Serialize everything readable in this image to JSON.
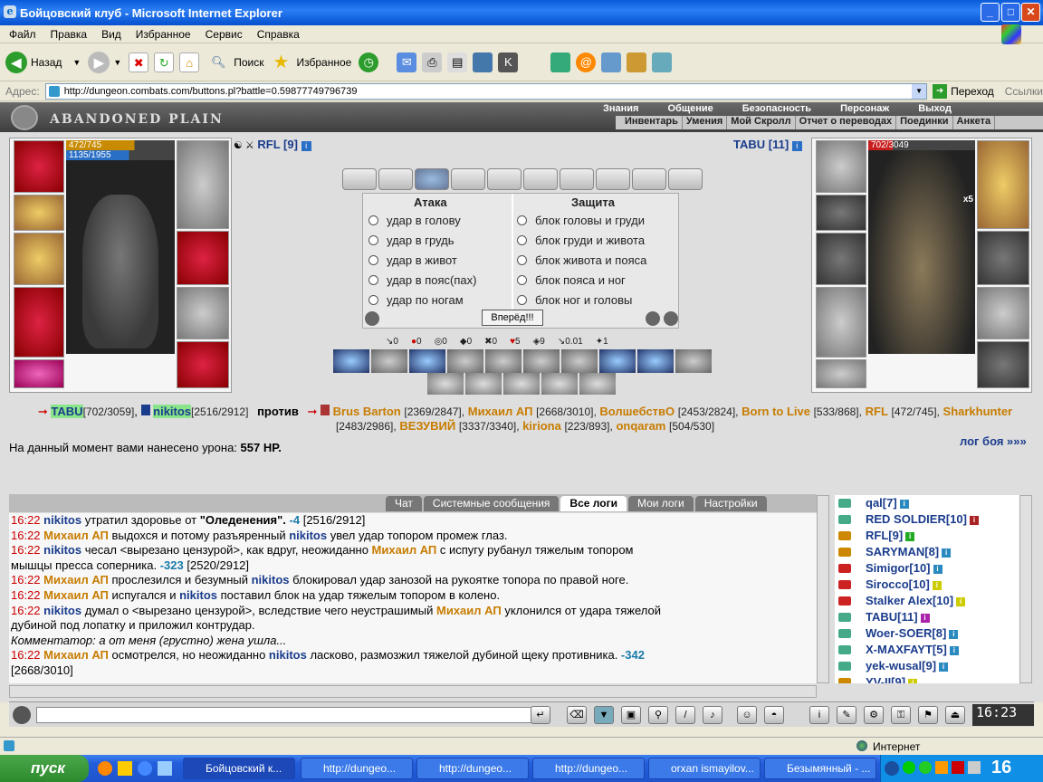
{
  "window": {
    "title": "Бойцовский клуб - Microsoft Internet Explorer",
    "buttons": [
      "_",
      "□",
      "✕"
    ]
  },
  "menu": [
    "Файл",
    "Правка",
    "Вид",
    "Избранное",
    "Сервис",
    "Справка"
  ],
  "toolbar": {
    "back": "Назад",
    "search": "Поиск",
    "favorites": "Избранное"
  },
  "address": {
    "label": "Адрес:",
    "url": "http://dungeon.combats.com/buttons.pl?battle=0.59877749796739",
    "go": "Переход",
    "links": "Ссылки"
  },
  "game": {
    "location": "ABANDONED PLAIN",
    "top_menu": [
      "Знания",
      "Общение",
      "Безопасность",
      "Персонаж",
      "Выход"
    ],
    "sub_menu": [
      "Инвентарь",
      "Умения",
      "Мой Скролл",
      "Отчет о переводах",
      "Поединки",
      "Анкета"
    ],
    "player": {
      "name": "RFL [9]",
      "hp": "472/745",
      "mana": "1135/1955"
    },
    "enemy": {
      "name": "TABU [11]",
      "hp": "702/3049",
      "count": "x5"
    },
    "attack": {
      "title": "Атака",
      "options": [
        "удар в голову",
        "удар в грудь",
        "удар в живот",
        "удар в пояс(пах)",
        "удар по ногам"
      ]
    },
    "defense": {
      "title": "Защита",
      "options": [
        "блок головы и груди",
        "блок груди и живота",
        "блок живота и пояса",
        "блок пояса и ног",
        "блок ног и головы"
      ]
    },
    "forward_button": "Вперёд!!!",
    "stats": [
      "0",
      "0",
      "0",
      "0",
      "0",
      "5",
      "9",
      "0.01",
      "1"
    ],
    "team1": [
      {
        "name": "TABU",
        "hp": "[702/3059]"
      },
      {
        "name": "nikitos",
        "hp": "[2516/2912]"
      }
    ],
    "vs": "против",
    "team2": [
      {
        "name": "Brus Barton",
        "hp": "[2369/2847],"
      },
      {
        "name": "Михаил АП",
        "hp": "[2668/3010],"
      },
      {
        "name": "ВолшебствО",
        "hp": "[2453/2824],"
      },
      {
        "name": "Born to Live",
        "hp": "[533/868],"
      },
      {
        "name": "RFL",
        "hp": "[472/745],"
      },
      {
        "name": "Sharkhunter",
        "hp": "[2483/2986],"
      },
      {
        "name": "ВЕЗУВИЙ",
        "hp": "[3337/3340],"
      },
      {
        "name": "kiriona",
        "hp": "[223/893],"
      },
      {
        "name": "onqaram",
        "hp": "[504/530]"
      }
    ],
    "damage_text": "На данный момент вами нанесено урона:",
    "damage_value": "557 HP.",
    "battle_log_link": "лог боя »»»"
  },
  "chat": {
    "tabs": [
      "Чат",
      "Системные сообщения",
      "Все логи",
      "Мои логи",
      "Настройки"
    ],
    "log": [
      {
        "t": "16:22",
        "a": "nikitos",
        "text": " утратил здоровье от ",
        "b": "\"Оледенения\".",
        "dmg": " -4",
        "hp": " [2516/2912]"
      },
      {
        "t": "16:22",
        "a": "Михаил АП",
        "text": " выдохся и потому разъяренный ",
        "b": "nikitos",
        "text2": " увел удар топором промеж глаз."
      },
      {
        "t": "16:22",
        "a": "nikitos",
        "text": " чесал <вырезано цензурой>, как вдруг, неожиданно ",
        "b": "Михаил АП",
        "text2": " с испугу рубанул тяжелым топором"
      },
      {
        "cont": "мышцы пресса соперника.",
        "dmg": " -323",
        "hp": " [2520/2912]"
      },
      {
        "t": "16:22",
        "a": "Михаил АП",
        "text": " прослезился и безумный ",
        "b": "nikitos",
        "text2": " блокировал удар занозой на рукоятке топора по правой ноге."
      },
      {
        "t": "16:22",
        "a": "Михаил АП",
        "text": " испугался и ",
        "b": "nikitos",
        "text2": " поставил блок на удар тяжелым топором в колено."
      },
      {
        "t": "16:22",
        "a": "nikitos",
        "text": " думал о <вырезано цензурой>, вследствие чего неустрашимый ",
        "b": "Михаил АП",
        "text2": " уклонился от удара тяжелой"
      },
      {
        "cont": "дубиной под лопатку и приложил контрудар."
      },
      {
        "comment": "Комментатор: а от меня (грустно) жена ушла..."
      },
      {
        "t": "16:22",
        "a": "Михаил АП",
        "text": " осмотрелся, но неожиданно ",
        "b": "nikitos",
        "text2": " ласково, размозжил тяжелой дубиной щеку противника.",
        "dmg": " -342"
      },
      {
        "cont": "[2668/3010]"
      }
    ],
    "users": [
      "qal[7]",
      "RED SOLDIER[10]",
      "RFL[9]",
      "SARYMAN[8]",
      "Simigor[10]",
      "Sirocco[10]",
      "Stalker Alex[10]",
      "TABU[11]",
      "Woer-SOER[8]",
      "X-MAXFAYT[5]",
      "yek-wusal[9]",
      "YV-II[9]"
    ],
    "clock": "16:23"
  },
  "status": {
    "zone": "Интернет"
  },
  "taskbar": {
    "start": "пуск",
    "tasks": [
      "Бойцовский к...",
      "http://dungeo...",
      "http://dungeo...",
      "http://dungeo...",
      "orxan ismayilov...",
      "Безымянный - ..."
    ],
    "time": "16"
  }
}
